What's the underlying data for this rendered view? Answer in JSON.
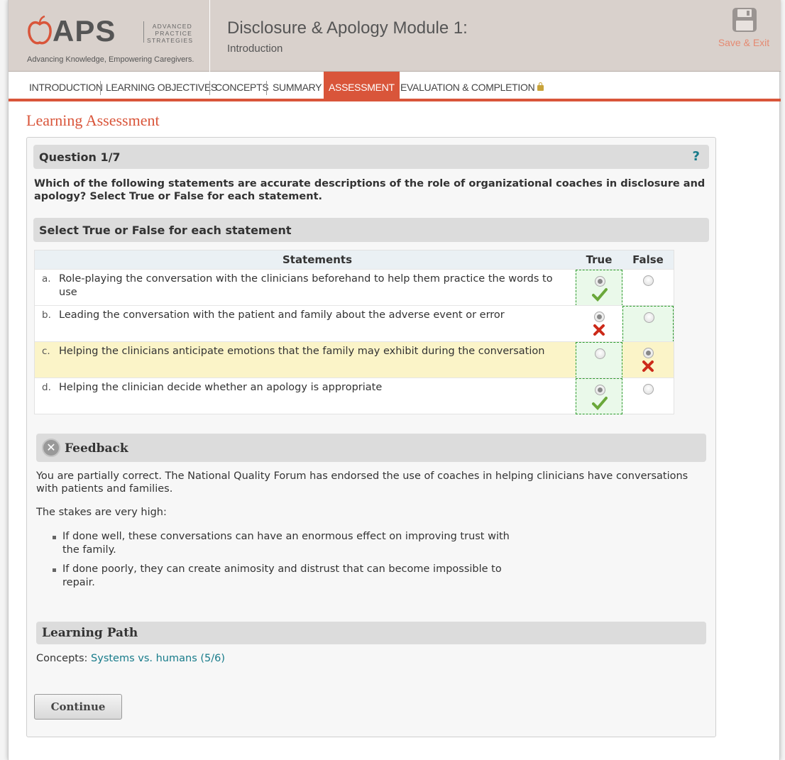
{
  "header": {
    "logo_text": "APS",
    "logo_sub": [
      "ADVANCED",
      "PRACTICE",
      "STRATEGIES"
    ],
    "tagline": "Advancing Knowledge, Empowering Caregivers.",
    "module_title": "Disclosure & Apology Module 1:",
    "module_subtitle": "Introduction",
    "save_exit_label": "Save & Exit"
  },
  "nav": {
    "items": [
      {
        "label": "INTRODUCTION"
      },
      {
        "label": "LEARNING OBJECTIVES"
      },
      {
        "label": "CONCEPTS"
      },
      {
        "label": "SUMMARY"
      },
      {
        "label": "ASSESSMENT",
        "active": true
      },
      {
        "label": "EVALUATION & COMPLETION",
        "locked": true
      }
    ]
  },
  "page_heading": "Learning Assessment",
  "question": {
    "title": "Question 1/7",
    "help_label": "?",
    "text": "Which of the following statements are accurate descriptions of the role of organizational coaches in disclosure and apology? Select True or False for each statement.",
    "instruction": "Select True or False for each statement"
  },
  "table": {
    "headers": {
      "statements": "Statements",
      "true": "True",
      "false": "False"
    },
    "rows": [
      {
        "letter": "a.",
        "text": "Role-playing the conversation with the clinicians beforehand to help them practice the words to use",
        "selected": "true",
        "correct": "true",
        "result": "check"
      },
      {
        "letter": "b.",
        "text": "Leading the conversation with the patient and family about the adverse event or error",
        "selected": "true",
        "correct": "false",
        "result": "cross"
      },
      {
        "letter": "c.",
        "text": "Helping the clinicians anticipate emotions that the family may exhibit during the conversation",
        "selected": "false",
        "correct": "true",
        "result": "cross",
        "highlighted": true
      },
      {
        "letter": "d.",
        "text": "Helping the clinician decide whether an apology is appropriate",
        "selected": "true",
        "correct": "true",
        "result": "check"
      }
    ]
  },
  "feedback": {
    "title": "Feedback",
    "icon": "circle-x-icon",
    "p1": "You are partially correct. The National Quality Forum has endorsed the use of coaches in helping clinicians have conversations with patients and families.",
    "p2": "The stakes are very high:",
    "bullets": [
      "If done well, these conversations can have an enormous effect on improving trust with the family.",
      "If done poorly, they can create animosity and distrust that can become impossible to repair."
    ]
  },
  "learning_path": {
    "title": "Learning Path",
    "prefix": "Concepts: ",
    "link": "Systems vs. humans (5/6)"
  },
  "continue_label": "Continue",
  "colors": {
    "accent": "#d9553a",
    "link": "#177b8a",
    "header_bg": "#d9d1cc",
    "correct_bg": "#eaf9ea",
    "highlight": "#fbf4c8"
  }
}
